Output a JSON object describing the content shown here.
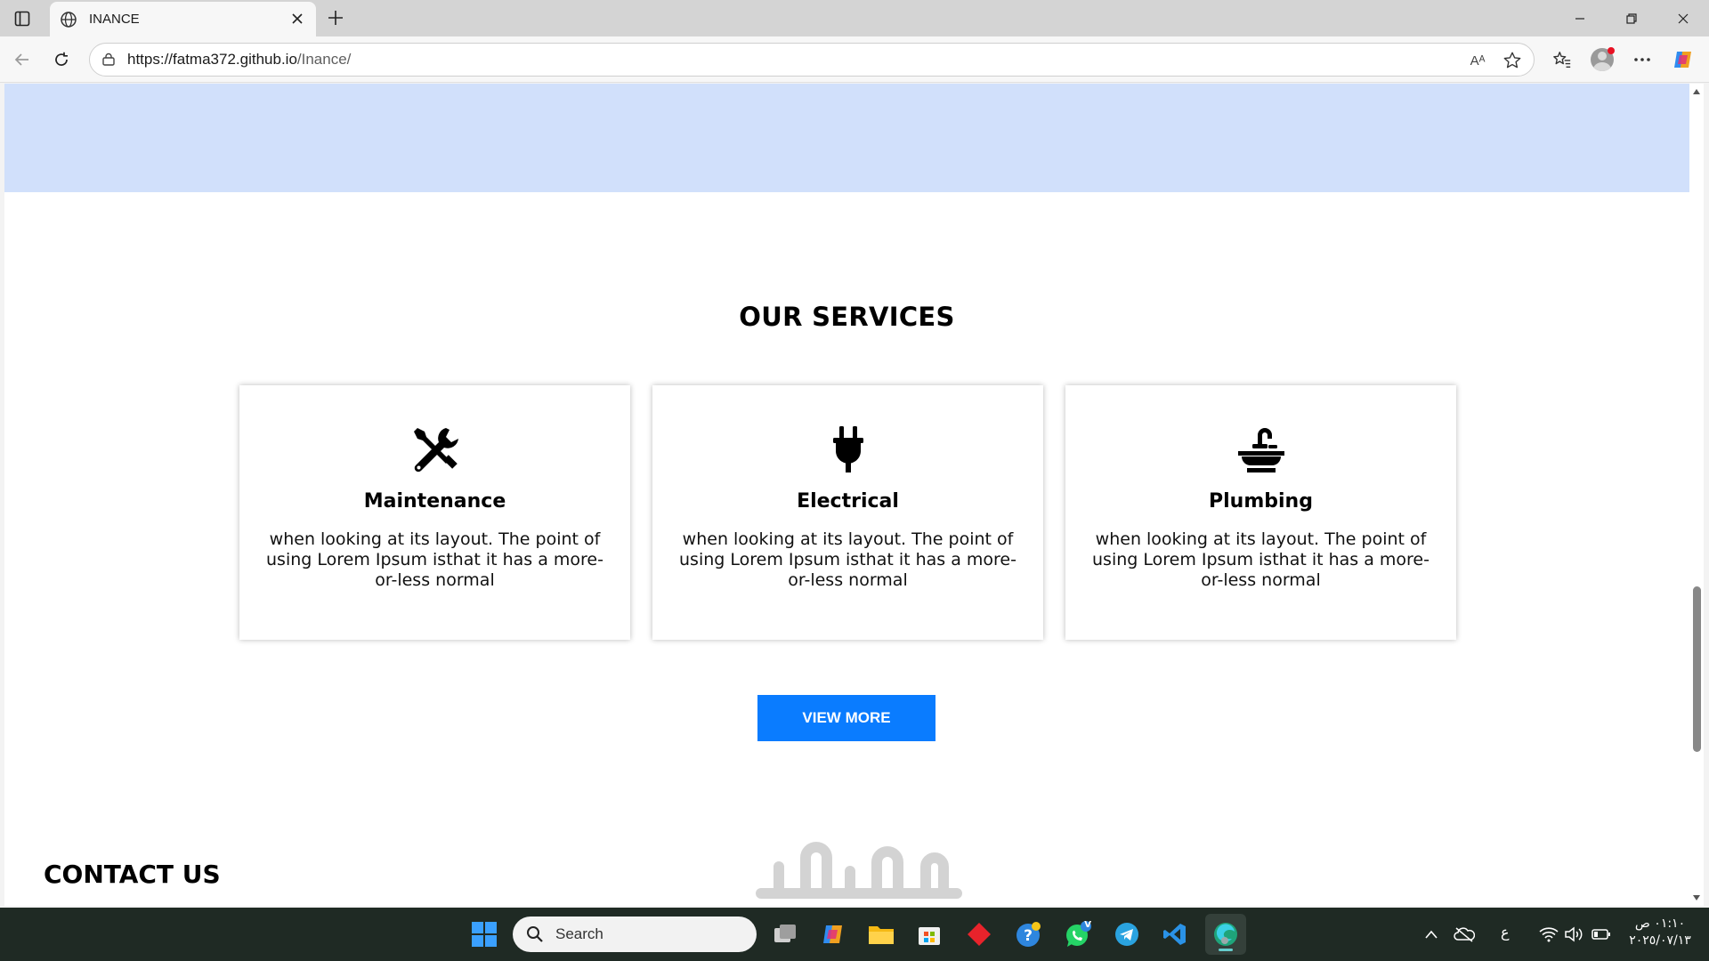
{
  "browser": {
    "tab_title": "INANCE",
    "url_host": "https://fatma372.github.io",
    "url_path": "/Inance/",
    "read_aloud_label": "Aᴬ"
  },
  "page": {
    "services_title": "OUR SERVICES",
    "services": [
      {
        "icon": "tools-icon",
        "title": "Maintenance",
        "text": "when looking at its layout. The point of using Lorem Ipsum isthat it has a more-or-less normal"
      },
      {
        "icon": "plug-icon",
        "title": "Electrical",
        "text": "when looking at its layout. The point of using Lorem Ipsum isthat it has a more-or-less normal"
      },
      {
        "icon": "faucet-icon",
        "title": "Plumbing",
        "text": "when looking at its layout. The point of using Lorem Ipsum isthat it has a more-or-less normal"
      }
    ],
    "view_more_label": "VIEW MORE",
    "contact_title": "CONTACT US",
    "hero_band_color": "#d1e0fb",
    "button_color": "#0a7cff"
  },
  "taskbar": {
    "search_placeholder": "Search",
    "keyboard_lang": "ع",
    "clock_time": "٠١:١٠ ص",
    "clock_date": "٢٠٢٥/٠٧/١٣",
    "whatsapp_badge": "V"
  }
}
